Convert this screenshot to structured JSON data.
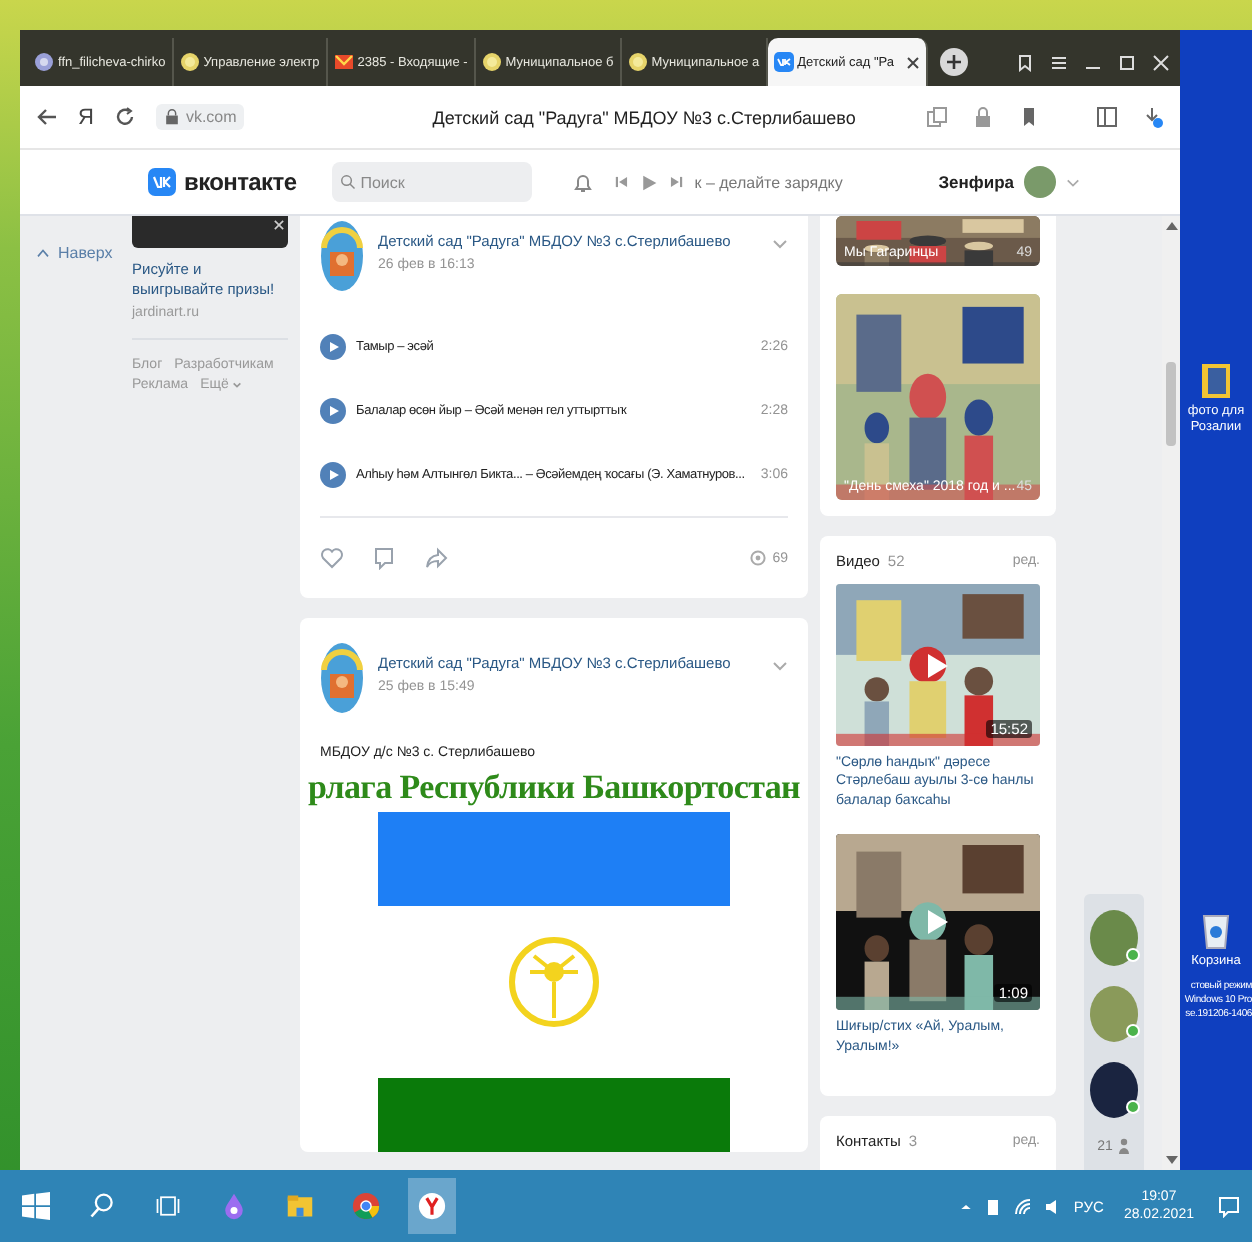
{
  "browser": {
    "tabs": [
      {
        "title": "ffn_filicheva-chirko",
        "kind": "globe",
        "selected": false
      },
      {
        "title": "Управление электр",
        "kind": "sun",
        "selected": false
      },
      {
        "title": "2385 - Входящие -",
        "kind": "mail",
        "selected": false
      },
      {
        "title": "Муниципальное б",
        "kind": "sun",
        "selected": false
      },
      {
        "title": "Муниципальное а",
        "kind": "sun",
        "selected": false
      },
      {
        "title": "Детский сад \"Ра",
        "kind": "vk",
        "selected": true
      }
    ],
    "toolbar": {
      "yandex_key": "Я",
      "address": "vk.com",
      "page_title": "Детский сад \"Радуга\" МБДОУ №3 с.Стерлибашево"
    }
  },
  "vk": {
    "header": {
      "logo": "вконтакте",
      "search_placeholder": "Поиск",
      "now_playing": "к – делайте зарядку",
      "user": "Зенфира"
    },
    "nav": {
      "up": "Наверх"
    },
    "ad": {
      "title": "Рисуйте и выигрывайте призы!",
      "domain": "jardinart.ru",
      "footer_links": [
        "Блог",
        "Разработчикам",
        "Реклама",
        "Ещё"
      ]
    },
    "posts": [
      {
        "kind": "audio",
        "author": "Детский сад \"Радуга\" МБДОУ №3 с.Стерлибашево",
        "date": "26 фев в 16:13",
        "tracks": [
          {
            "name": "Тамыр – эсәй",
            "duration": "2:26"
          },
          {
            "name": "Балалар өсөн йыр – Әсәй менән гел уттырттыҡ",
            "duration": "2:28"
          },
          {
            "name": "Алһыу һәм Алтынгөл Бикта... – Әсәйемдең ҡосағы (Э. Хаматнуров...",
            "duration": "3:06"
          }
        ],
        "views": "69"
      },
      {
        "author": "Детский сад \"Радуга\" МБДОУ №3 с.Стерлибашево",
        "date": "25 фев в 15:49",
        "text": "МБДОУ д/с №3 с. Стерлибашево",
        "image_heading": "рлага Республики Башкортостан"
      }
    ],
    "sidebar": {
      "albums": [
        {
          "title": "Мы Гагаринцы",
          "count": "49"
        },
        {
          "title": "\"День смеха\" 2018 год и ...",
          "count": "45"
        }
      ],
      "videos": {
        "title": "Видео",
        "count": "52",
        "edit": "ред.",
        "items": [
          {
            "duration": "15:52",
            "caption": "\"Сөрлө һандыҡ\" дәресе Стәрлебаш ауылы 3-сө һанлы балалар баҡсаһы"
          },
          {
            "duration": "1:09",
            "caption": "Шиғыр/стих «Ай, Уралым, Уралым!»"
          }
        ]
      },
      "contacts": {
        "title": "Контакты",
        "count": "3",
        "edit": "ред."
      }
    },
    "online": {
      "friends": [
        {
          "online": true
        },
        {
          "online": true
        },
        {
          "online": true
        }
      ],
      "count": "21"
    }
  },
  "desktop": {
    "icons": [
      {
        "kind": "folder",
        "label": "фото для Розалии"
      },
      {
        "kind": "bin",
        "label": "Корзина"
      }
    ],
    "test_mode_notice": [
      "стовый режим",
      "Windows 10 Pro",
      "se.191206-1406"
    ]
  },
  "taskbar": {
    "apps": [
      {
        "kind": "start",
        "selected": false
      },
      {
        "kind": "search",
        "selected": false
      },
      {
        "kind": "taskview",
        "selected": false
      },
      {
        "kind": "assistant",
        "selected": false
      },
      {
        "kind": "explorer",
        "selected": false
      },
      {
        "kind": "chrome",
        "selected": false
      },
      {
        "kind": "yandex",
        "selected": true
      }
    ],
    "tray": {
      "language": "РУС",
      "time": "19:07",
      "date": "28.02.2021"
    }
  }
}
